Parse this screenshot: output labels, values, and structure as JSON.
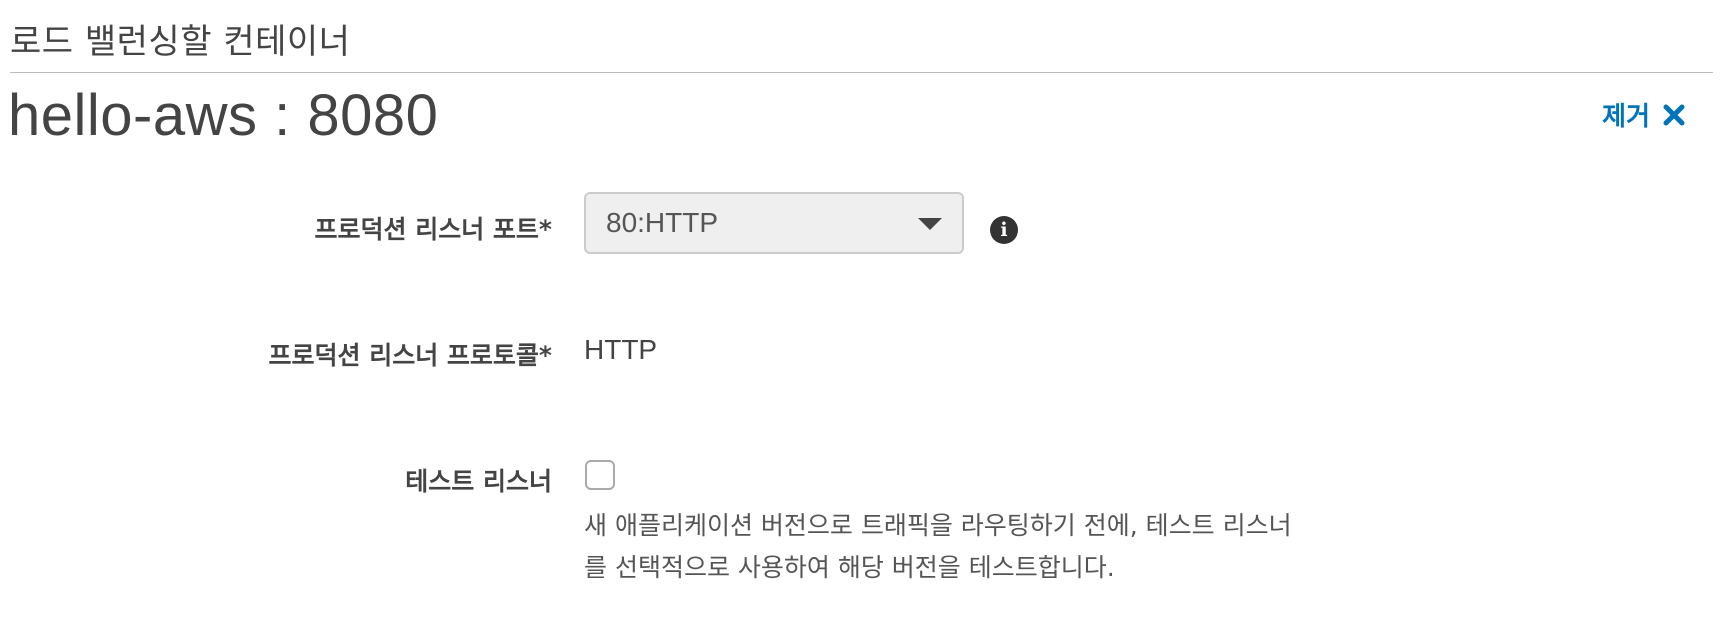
{
  "section": {
    "title": "로드 밸런싱할 컨테이너"
  },
  "container": {
    "name": "hello-aws : 8080",
    "remove_label": "제거",
    "remove_icon": "close-icon"
  },
  "form": {
    "port": {
      "label": "프로덕션 리스너 포트*",
      "selected": "80:HTTP",
      "info_icon": "info-icon"
    },
    "protocol": {
      "label": "프로덕션 리스너 프로토콜*",
      "value": "HTTP"
    },
    "test_listener": {
      "label": "테스트 리스너",
      "checked": false,
      "help_line1": "새 애플리케이션 버전으로 트래픽을 라우팅하기 전에, 테스트 리스너",
      "help_line2": "를 선택적으로 사용하여 해당 버전을 테스트합니다."
    }
  },
  "colors": {
    "link": "#0073bb",
    "text": "#444444",
    "select_bg": "#efefef"
  }
}
